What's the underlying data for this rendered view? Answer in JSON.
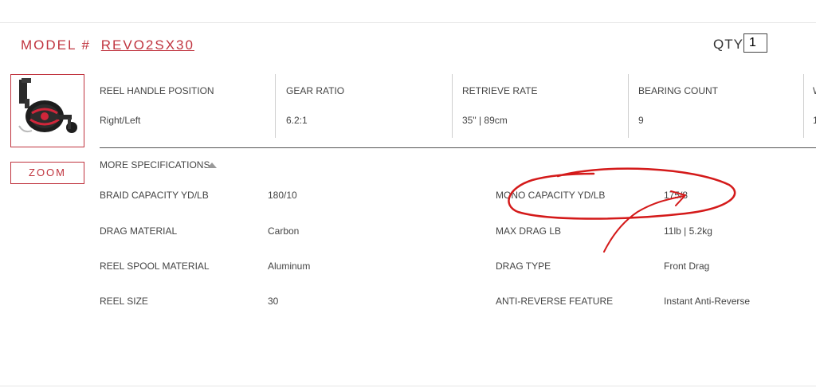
{
  "header": {
    "model_prefix": "MODEL #",
    "model_number": "REVO2SX30",
    "qty_label": "QTY:",
    "qty_value": "1"
  },
  "product": {
    "image_icon": "reel-icon",
    "zoom_label": "ZOOM"
  },
  "key_specs": [
    {
      "label": "REEL HANDLE POSITION",
      "value": "Right/Left"
    },
    {
      "label": "GEAR RATIO",
      "value": "6.2:1"
    },
    {
      "label": "RETRIEVE RATE",
      "value": "35\" | 89cm"
    },
    {
      "label": "BEARING COUNT",
      "value": "9"
    },
    {
      "label": "W",
      "value": "1"
    }
  ],
  "more_specs": {
    "toggle_label": "MORE SPECIFICATIONS",
    "left": [
      {
        "label": "BRAID CAPACITY YD/LB",
        "value": "180/10"
      },
      {
        "label": "DRAG MATERIAL",
        "value": "Carbon"
      },
      {
        "label": "REEL SPOOL MATERIAL",
        "value": "Aluminum"
      },
      {
        "label": "REEL SIZE",
        "value": "30"
      }
    ],
    "right": [
      {
        "label": "MONO CAPACITY YD/LB",
        "value": "175/8"
      },
      {
        "label": "MAX DRAG LB",
        "value": "11lb | 5.2kg"
      },
      {
        "label": "DRAG TYPE",
        "value": "Front Drag"
      },
      {
        "label": "ANTI-REVERSE FEATURE",
        "value": "Instant Anti-Reverse"
      }
    ]
  },
  "colors": {
    "accent": "#c0343f",
    "annotation": "#d41a1a"
  }
}
